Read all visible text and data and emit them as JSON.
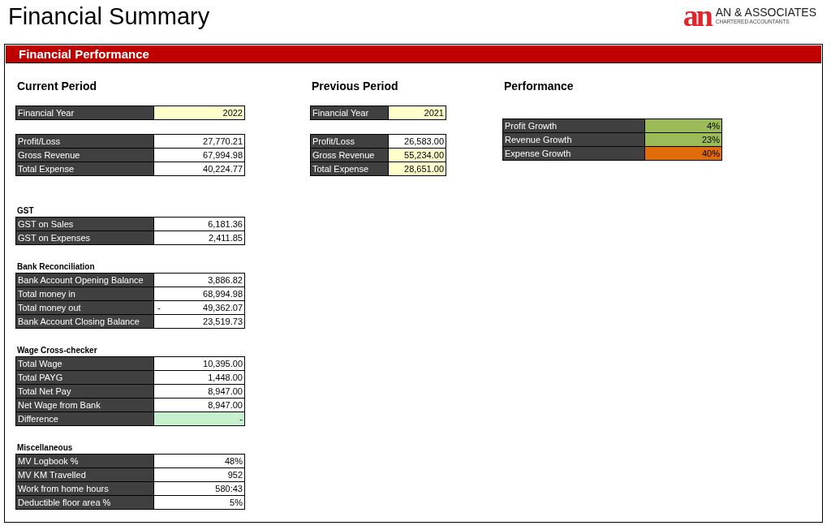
{
  "title": "Financial Summary",
  "logo": {
    "mark": "an",
    "name": "AN & ASSOCIATES",
    "tagline": "CHARTERED ACCOUNTANTS"
  },
  "panel": {
    "title": "Financial Performance",
    "columns": [
      {
        "title": "Current Period",
        "groups": [
          {
            "rows": [
              {
                "label": "Financial Year",
                "value": "2022",
                "color": "#ffffcc"
              }
            ]
          },
          {
            "rows": [
              {
                "label": "Profit/Loss",
                "value": "27,770.21",
                "color": "#ffffff"
              },
              {
                "label": "Gross Revenue",
                "value": "67,994.98",
                "color": "#ffffff"
              },
              {
                "label": "Total Expense",
                "value": "40,224.77",
                "color": "#ffffff"
              }
            ]
          },
          {
            "title": "GST",
            "rows": [
              {
                "label": "GST on Sales",
                "value": "6,181.36",
                "color": "#ffffff"
              },
              {
                "label": "GST on Expenses",
                "value": "2,411.85",
                "color": "#ffffff"
              }
            ]
          },
          {
            "title": "Bank Reconciliation",
            "rows": [
              {
                "label": "Bank Account Opening Balance",
                "value": "3,886.82",
                "color": "#ffffff"
              },
              {
                "label": "Total money in",
                "value": "68,994.98",
                "color": "#ffffff"
              },
              {
                "label": "Total money out",
                "prefix": "-",
                "value": "49,362.07",
                "color": "#ffffff"
              },
              {
                "label": "Bank Account Closing Balance",
                "value": "23,519.73",
                "color": "#ffffff"
              }
            ]
          },
          {
            "title": "Wage Cross-checker",
            "rows": [
              {
                "label": "Total Wage",
                "value": "10,395.00",
                "color": "#ffffff"
              },
              {
                "label": "Total PAYG",
                "value": "1,448.00",
                "color": "#ffffff"
              },
              {
                "label": "Total Net Pay",
                "value": "8,947.00",
                "color": "#ffffff"
              },
              {
                "label": "Net Wage from Bank",
                "value": "8,947.00",
                "color": "#ffffff"
              },
              {
                "label": "Difference",
                "value": "-",
                "color": "#c6efce"
              }
            ]
          },
          {
            "title": "Miscellaneous",
            "rows": [
              {
                "label": "MV Logbook %",
                "value": "48%",
                "color": "#ffffff"
              },
              {
                "label": "MV KM Travelled",
                "value": "952",
                "color": "#ffffff"
              },
              {
                "label": "Work from home hours",
                "value": "580:43",
                "color": "#ffffff"
              },
              {
                "label": "Deductible floor area %",
                "value": "5%",
                "color": "#ffffff"
              }
            ]
          }
        ]
      },
      {
        "title": "Previous Period",
        "groups": [
          {
            "rows": [
              {
                "label": "Financial Year",
                "value": "2021",
                "color": "#ffffcc"
              }
            ]
          },
          {
            "rows": [
              {
                "label": "Profit/Loss",
                "value": "26,583.00",
                "color": "#ffffff"
              },
              {
                "label": "Gross Revenue",
                "value": "55,234.00",
                "color": "#ffffcc"
              },
              {
                "label": "Total Expense",
                "value": "28,651.00",
                "color": "#ffffcc"
              }
            ]
          }
        ]
      },
      {
        "title": "Performance",
        "groups": [
          {
            "rows": [
              {
                "label": "Profit Growth",
                "value": "4%",
                "color": "#9bbb59"
              },
              {
                "label": "Revenue Growth",
                "value": "23%",
                "color": "#9bbb59"
              },
              {
                "label": "Expense Growth",
                "value": "40%",
                "color": "#e26b0a"
              }
            ]
          }
        ]
      }
    ]
  }
}
